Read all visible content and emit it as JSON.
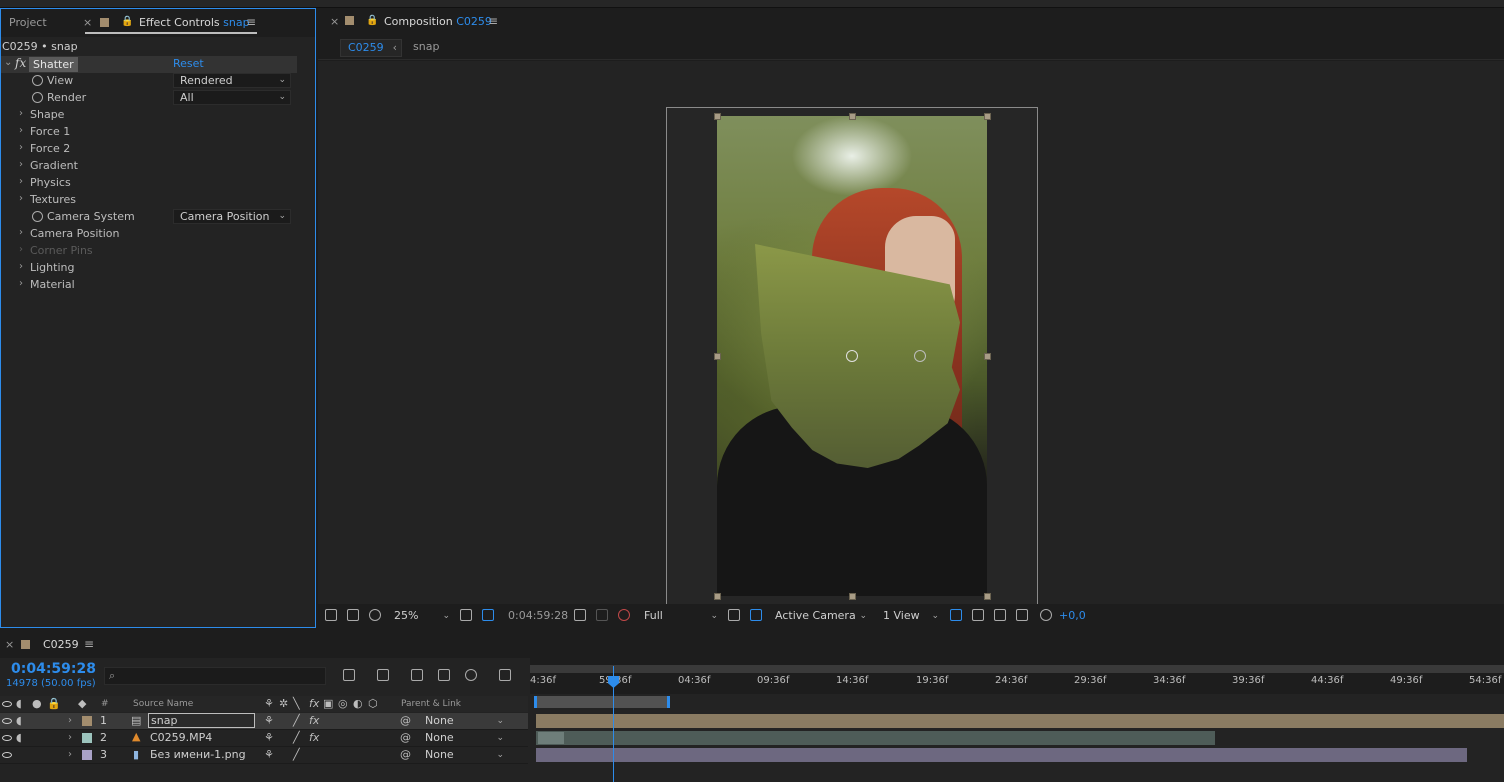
{
  "effect_controls": {
    "tabs": {
      "project": "Project",
      "effect_controls": "Effect Controls",
      "effect_controls_layer": "snap"
    },
    "breadcrumb": "C0259 • snap",
    "effect": {
      "fx_label": "fx",
      "name": "Shatter",
      "reset": "Reset",
      "rows": [
        {
          "label": "View",
          "value": "Rendered",
          "stopwatch": true
        },
        {
          "label": "Render",
          "value": "All",
          "stopwatch": true
        },
        {
          "label": "Shape"
        },
        {
          "label": "Force 1"
        },
        {
          "label": "Force 2"
        },
        {
          "label": "Gradient"
        },
        {
          "label": "Physics"
        },
        {
          "label": "Textures"
        },
        {
          "label": "Camera System",
          "value": "Camera Position",
          "stopwatch": true
        },
        {
          "label": "Camera Position"
        },
        {
          "label": "Corner Pins",
          "disabled": true
        },
        {
          "label": "Lighting"
        },
        {
          "label": "Material"
        }
      ]
    }
  },
  "composition": {
    "tab_prefix": "Composition",
    "tab_name": "C0259",
    "sub_chip": "C0259",
    "sub_layer": "snap",
    "toolbar": {
      "zoom": "25%",
      "timecode": "0:04:59:28",
      "resolution": "Full",
      "camera": "Active Camera",
      "views": "1 View",
      "exposure": "+0,0"
    }
  },
  "timeline": {
    "tab": "C0259",
    "timecode": "0:04:59:28",
    "frames": "14978 (50.00 fps)",
    "search_placeholder": "",
    "columns": {
      "hash": "#",
      "source_name": "Source Name",
      "parent_link": "Parent & Link"
    },
    "layers": [
      {
        "num": "1",
        "name": "snap",
        "parent": "None",
        "fx": true,
        "color": "#a38d6e"
      },
      {
        "num": "2",
        "name": "C0259.MP4",
        "parent": "None",
        "fx": true,
        "color": "#9cc4bd"
      },
      {
        "num": "3",
        "name": "Без имени-1.png",
        "parent": "None",
        "fx": false,
        "color": "#a9a2c7"
      }
    ],
    "ruler_ticks": [
      "4:36f",
      "59:36f",
      "04:36f",
      "09:36f",
      "14:36f",
      "19:36f",
      "24:36f",
      "29:36f",
      "34:36f",
      "39:36f",
      "44:36f",
      "49:36f",
      "54:36f"
    ]
  },
  "colors": {
    "accent": "#2d8ceb",
    "layer1_bar": "#8a7b62",
    "layer2_bar": "#4e5c58",
    "layer3_bar": "#6d6880"
  }
}
